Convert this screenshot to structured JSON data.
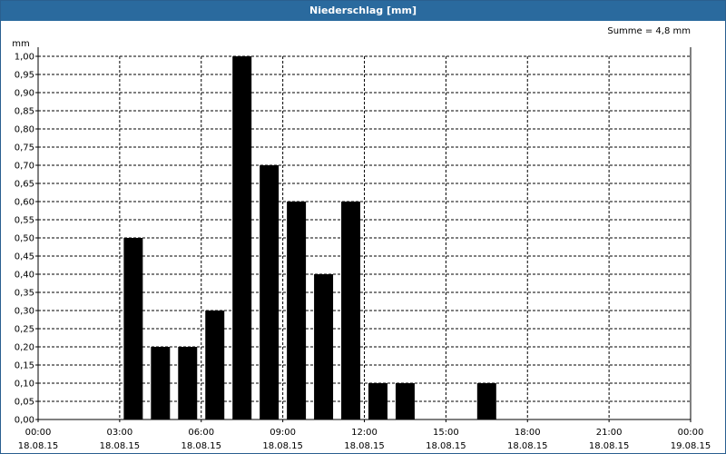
{
  "window": {
    "title": "Niederschlag [mm]"
  },
  "chart_data": {
    "type": "bar",
    "title": "Niederschlag [mm]",
    "ylabel": "mm",
    "annotation": "Summe = 4,8 mm",
    "ylim": [
      0,
      1
    ],
    "y_ticks": [
      "0,00",
      "0,05",
      "0,10",
      "0,15",
      "0,20",
      "0,25",
      "0,30",
      "0,35",
      "0,40",
      "0,45",
      "0,50",
      "0,55",
      "0,60",
      "0,65",
      "0,70",
      "0,75",
      "0,80",
      "0,85",
      "0,90",
      "0,95",
      "1,00"
    ],
    "x_ticks": [
      {
        "hour": 0,
        "time": "00:00",
        "date": "18.08.15"
      },
      {
        "hour": 3,
        "time": "03:00",
        "date": "18.08.15"
      },
      {
        "hour": 6,
        "time": "06:00",
        "date": "18.08.15"
      },
      {
        "hour": 9,
        "time": "09:00",
        "date": "18.08.15"
      },
      {
        "hour": 12,
        "time": "12:00",
        "date": "18.08.15"
      },
      {
        "hour": 15,
        "time": "15:00",
        "date": "18.08.15"
      },
      {
        "hour": 18,
        "time": "18:00",
        "date": "18.08.15"
      },
      {
        "hour": 21,
        "time": "21:00",
        "date": "18.08.15"
      },
      {
        "hour": 24,
        "time": "00:00",
        "date": "19.08.15"
      }
    ],
    "x_range_hours": [
      0,
      24
    ],
    "bars": [
      {
        "hour": 4,
        "value": 0.5
      },
      {
        "hour": 5,
        "value": 0.2
      },
      {
        "hour": 6,
        "value": 0.2
      },
      {
        "hour": 7,
        "value": 0.3
      },
      {
        "hour": 8,
        "value": 1.0
      },
      {
        "hour": 9,
        "value": 0.7
      },
      {
        "hour": 10,
        "value": 0.6
      },
      {
        "hour": 11,
        "value": 0.4
      },
      {
        "hour": 12,
        "value": 0.6
      },
      {
        "hour": 13,
        "value": 0.1
      },
      {
        "hour": 14,
        "value": 0.1
      },
      {
        "hour": 17,
        "value": 0.1
      }
    ],
    "grid": true,
    "bar_color": "#000000"
  }
}
